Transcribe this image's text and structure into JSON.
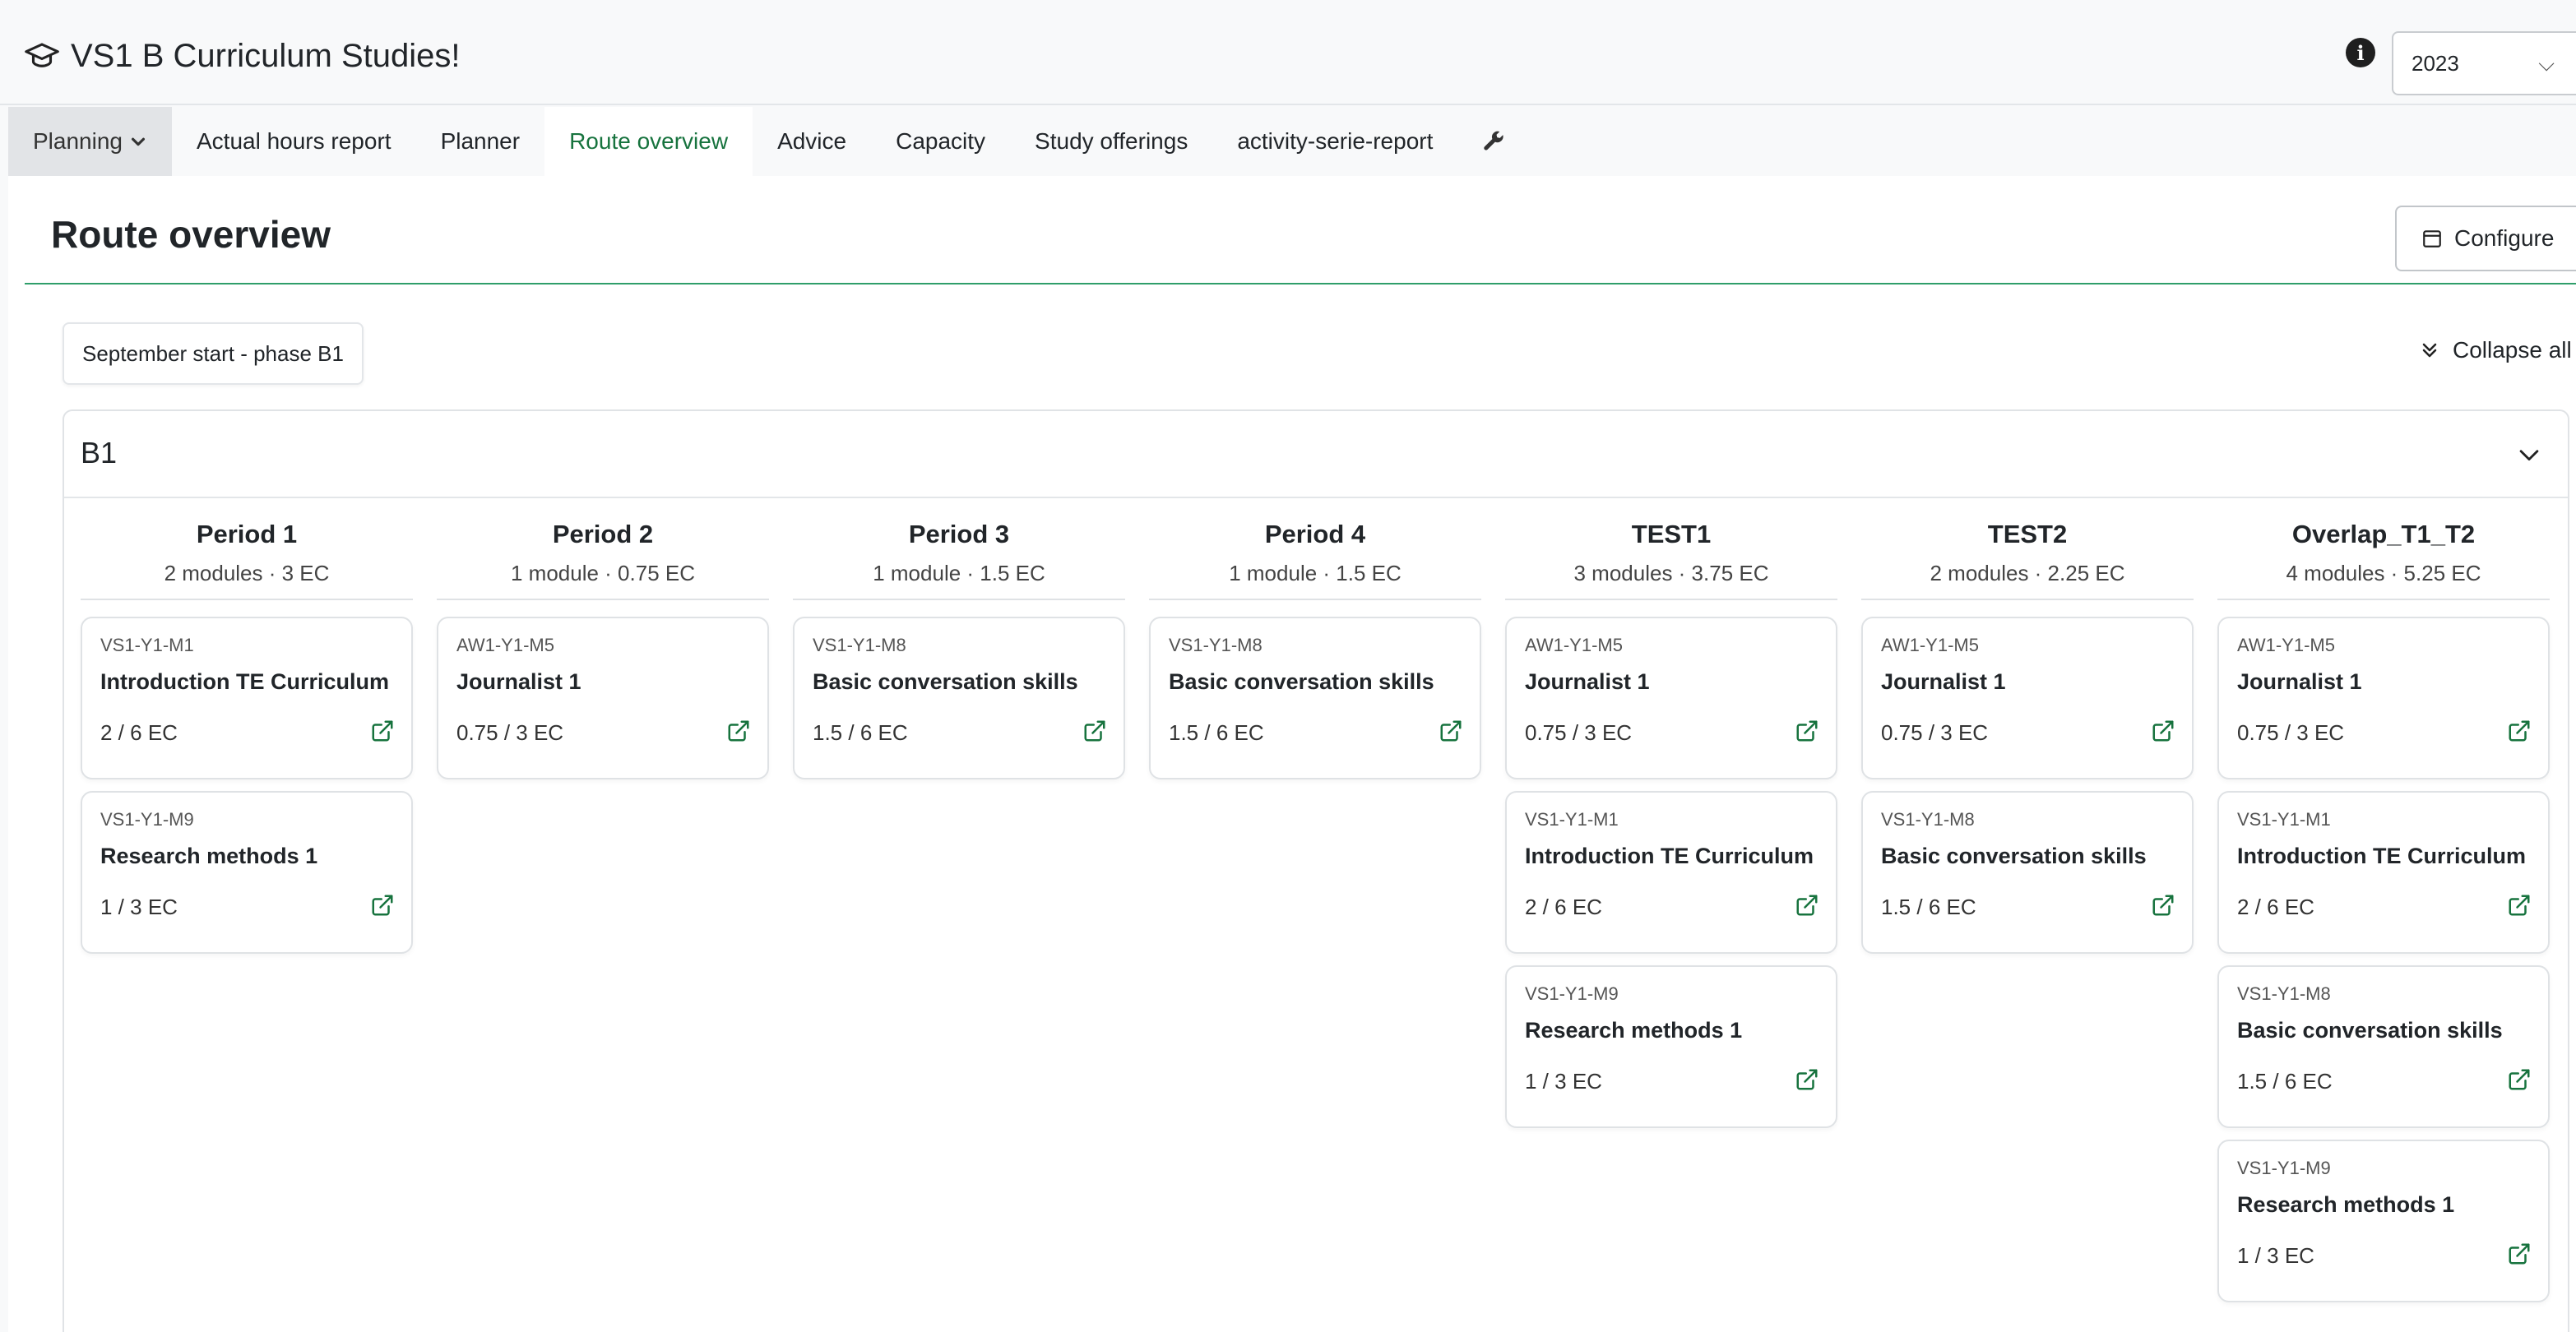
{
  "app": {
    "title": "VS1 B Curriculum Studies!",
    "year": "2023"
  },
  "nav": {
    "planning": "Planning",
    "actual_hours": "Actual hours report",
    "planner": "Planner",
    "route_overview": "Route overview",
    "advice": "Advice",
    "capacity": "Capacity",
    "study_offerings": "Study offerings",
    "activity_serie": "activity-serie-report"
  },
  "page": {
    "title": "Route overview",
    "configure": "Configure",
    "filter": "September start - phase B1",
    "collapse_all": "Collapse all"
  },
  "phase": {
    "title": "B1",
    "columns": [
      {
        "name": "Period 1",
        "meta": "2 modules · 3 EC",
        "modules": [
          {
            "code": "VS1-Y1-M1",
            "name": "Introduction TE Curriculum",
            "ec": "2 / 6 EC"
          },
          {
            "code": "VS1-Y1-M9",
            "name": "Research methods 1",
            "ec": "1 / 3 EC"
          }
        ]
      },
      {
        "name": "Period 2",
        "meta": "1 module · 0.75 EC",
        "modules": [
          {
            "code": "AW1-Y1-M5",
            "name": "Journalist 1",
            "ec": "0.75 / 3 EC"
          }
        ]
      },
      {
        "name": "Period 3",
        "meta": "1 module · 1.5 EC",
        "modules": [
          {
            "code": "VS1-Y1-M8",
            "name": "Basic conversation skills",
            "ec": "1.5 / 6 EC"
          }
        ]
      },
      {
        "name": "Period 4",
        "meta": "1 module · 1.5 EC",
        "modules": [
          {
            "code": "VS1-Y1-M8",
            "name": "Basic conversation skills",
            "ec": "1.5 / 6 EC"
          }
        ]
      },
      {
        "name": "TEST1",
        "meta": "3 modules · 3.75 EC",
        "modules": [
          {
            "code": "AW1-Y1-M5",
            "name": "Journalist 1",
            "ec": "0.75 / 3 EC"
          },
          {
            "code": "VS1-Y1-M1",
            "name": "Introduction TE Curriculum",
            "ec": "2 / 6 EC"
          },
          {
            "code": "VS1-Y1-M9",
            "name": "Research methods 1",
            "ec": "1 / 3 EC"
          }
        ]
      },
      {
        "name": "TEST2",
        "meta": "2 modules · 2.25 EC",
        "modules": [
          {
            "code": "AW1-Y1-M5",
            "name": "Journalist 1",
            "ec": "0.75 / 3 EC"
          },
          {
            "code": "VS1-Y1-M8",
            "name": "Basic conversation skills",
            "ec": "1.5 / 6 EC"
          }
        ]
      },
      {
        "name": "Overlap_T1_T2",
        "meta": "4 modules · 5.25 EC",
        "modules": [
          {
            "code": "AW1-Y1-M5",
            "name": "Journalist 1",
            "ec": "0.75 / 3 EC"
          },
          {
            "code": "VS1-Y1-M1",
            "name": "Introduction TE Curriculum",
            "ec": "2 / 6 EC"
          },
          {
            "code": "VS1-Y1-M8",
            "name": "Basic conversation skills",
            "ec": "1.5 / 6 EC"
          },
          {
            "code": "VS1-Y1-M9",
            "name": "Research methods 1",
            "ec": "1 / 3 EC"
          }
        ]
      }
    ]
  },
  "colors": {
    "accent": "#17733e",
    "rule": "#2f9e6a"
  }
}
